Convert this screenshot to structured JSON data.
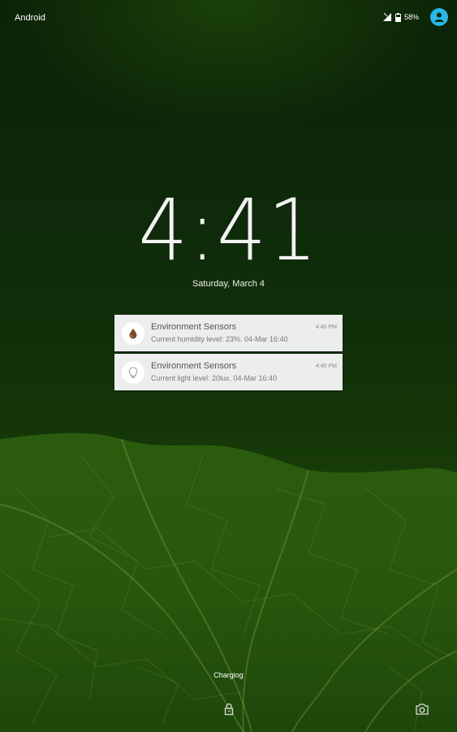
{
  "status_bar": {
    "carrier": "Android",
    "battery_percent": "58%",
    "icons": [
      "signal-icon",
      "battery-icon",
      "user-avatar-icon"
    ],
    "accent_color": "#29b6e8"
  },
  "clock": {
    "time": "4:41"
  },
  "date": "Saturday, March 4",
  "notifications": [
    {
      "icon": "humidity-drop-icon",
      "title": "Environment Sensors",
      "body": "Current humidity level: 23%. 04-Mar 16:40",
      "time": "4:40 PM"
    },
    {
      "icon": "light-bulb-icon",
      "title": "Environment Sensors",
      "body": "Current light level: 20lux. 04-Mar 16:40",
      "time": "4:40 PM"
    }
  ],
  "owner_info": "Chargiog",
  "bottom_actions": {
    "lock": "lock-icon",
    "camera": "camera-icon"
  }
}
